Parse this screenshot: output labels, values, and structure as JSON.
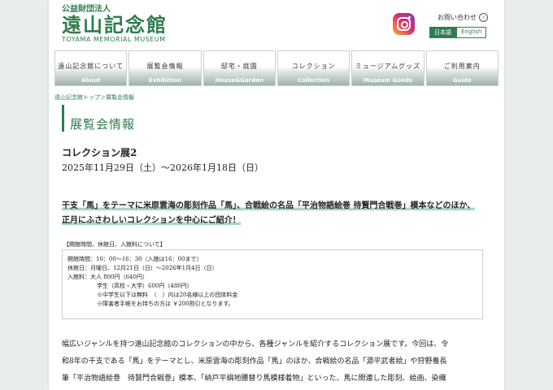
{
  "header": {
    "logo_sub": "公益財団法人",
    "logo_main": "遠山記念館",
    "logo_en": "TOYAMA MEMORIAL MUSEUM",
    "contact_label": "お問い合わせ",
    "lang_ja": "日本語",
    "lang_en": "English"
  },
  "nav": [
    {
      "jp": "遠山記念館について",
      "en": "About"
    },
    {
      "jp": "展覧会情報",
      "en": "Exhibition"
    },
    {
      "jp": "邸宅・庭園",
      "en": "House&Garden"
    },
    {
      "jp": "コレクション",
      "en": "Collection"
    },
    {
      "jp": "ミュージアムグッズ",
      "en": "Museum Goods"
    },
    {
      "jp": "ご利用案内",
      "en": "Guide"
    }
  ],
  "breadcrumb": "遠山記念館トップ＞展覧会情報",
  "page_title": "展覧会情報",
  "exhibition": {
    "title": "コレクション展2",
    "date": "2025年11月29日（土）～2026年1月18日（日）",
    "lead_1": "干支「馬」をテーマに米原雲海の彫刻作品「馬」、合戦絵の名品「平治物語絵巻 待賢門合戦巻」模本などのほか、",
    "lead_2": "正月にふさわしいコレクションを中心にご紹介！"
  },
  "info": {
    "label": "【開館時間、休館日、入館料について】",
    "hours": "開館時間：10：00～16：30（入館は16：00まで）",
    "closed": "休館日：月曜日、12月21日（日）～2026年1月4日（日）",
    "fee_1": "入館料：大人 800円（640円）",
    "fee_2": "学生（高校・大学）600円（480円）",
    "fee_3": "※中学生以下は無料　（　）内は20名様以上の団体料金",
    "fee_4": "※障害者手帳をお持ちの方は ￥200割引となります。"
  },
  "body": {
    "line_1": "幅広いジャンルを持つ遠山記念館のコレクションの中から、各種ジャンルを紹介するコレクション展です。今回は、令",
    "line_2": "和8年の干支である「馬」をテーマとし、米原雲海の彫刻作品「馬」のほか、合戦絵の名品「源平武者絵」や狩野養長",
    "line_3": "筆「平治物語絵巻　待賢門合戦巻」模本、「納戸平絹地腰替り馬模様着物」といった、馬に関連した彫刻、絵画、染織"
  },
  "colors": {
    "accent": "#2e7d4f",
    "highlight": "#a8d8c4"
  }
}
